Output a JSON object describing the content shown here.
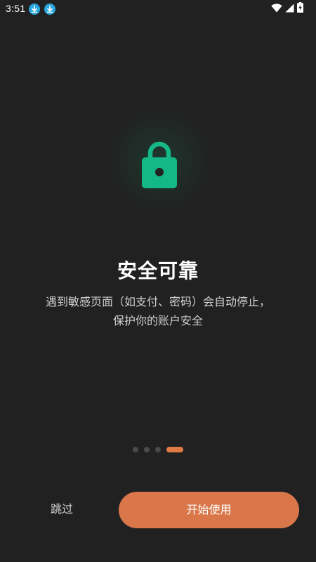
{
  "status_bar": {
    "time": "3:51",
    "icons": [
      "download-icon",
      "download-icon",
      "wifi-icon",
      "signal-icon",
      "battery-charging-icon"
    ]
  },
  "onboarding": {
    "illustration_icon": "lock-icon",
    "title": "安全可靠",
    "description_lines": [
      "遇到敏感页面（如支付、密码）会自动停止，",
      "保护你的账户安全"
    ],
    "pager": {
      "total": 4,
      "active_index": 3
    }
  },
  "actions": {
    "skip_label": "跳过",
    "start_label": "开始使用"
  },
  "colors": {
    "background": "#212121",
    "accent": "#d9774a",
    "lock_green": "#14b886",
    "status_download_blue": "#29a8e0",
    "dot_inactive": "#4a4a4a"
  }
}
